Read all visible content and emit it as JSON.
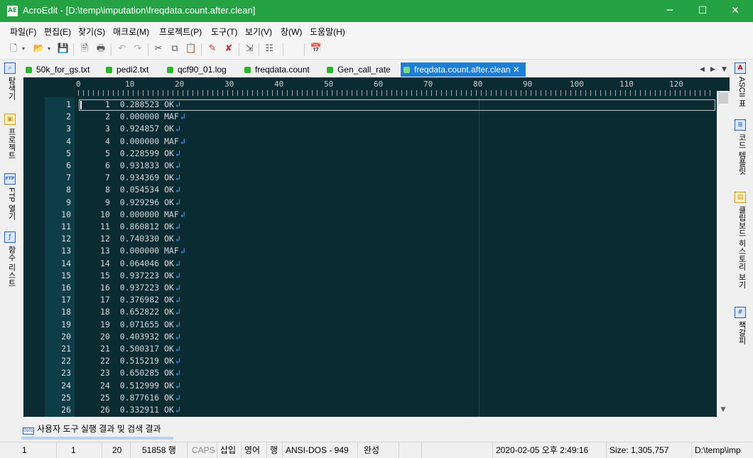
{
  "window": {
    "app_icon_text": "AE",
    "title": "AcroEdit - [D:\\temp\\imputation\\freqdata.count.after.clean]",
    "minimize": "─",
    "maximize": "☐",
    "close": "✕"
  },
  "menu": [
    "파일(F)",
    "편집(E)",
    "찾기(S)",
    "매크로(M)",
    "프로젝트(P)",
    "도구(T)",
    "보기(V)",
    "창(W)",
    "도움말(H)"
  ],
  "left_panel": [
    {
      "icon": "magnifier-icon",
      "label": "탐색기"
    },
    {
      "icon": "project-icon",
      "label": "프로젝트"
    },
    {
      "icon": "ftp-icon",
      "label": "FTP 열기"
    },
    {
      "icon": "function-list-icon",
      "label": "함수 리스트"
    }
  ],
  "right_panel": [
    {
      "icon": "ascii-icon",
      "label": "ASCII 표"
    },
    {
      "icon": "code-template-icon",
      "label": "코드 템플릿"
    },
    {
      "icon": "clipboard-icon",
      "label": "클립보드 히스토리 보기"
    },
    {
      "icon": "bookmark-icon",
      "label": "책갈피"
    }
  ],
  "tabs": [
    {
      "label": "50k_for_gs.txt",
      "active": false
    },
    {
      "label": "pedi2.txt",
      "active": false
    },
    {
      "label": "qcf90_01.log",
      "active": false
    },
    {
      "label": "freqdata.count",
      "active": false
    },
    {
      "label": "Gen_call_rate",
      "active": false
    },
    {
      "label": "freqdata.count.after.clean",
      "active": true
    }
  ],
  "tab_close": "✕",
  "ruler": [
    "0",
    "10",
    "20",
    "30",
    "40",
    "50",
    "60",
    "70",
    "80",
    "90",
    "100",
    "110",
    "120"
  ],
  "lines": [
    {
      "n": "1",
      "text": "1  0.288523 OK"
    },
    {
      "n": "2",
      "text": "2  0.000000 MAF"
    },
    {
      "n": "3",
      "text": "3  0.924857 OK"
    },
    {
      "n": "4",
      "text": "4  0.000000 MAF"
    },
    {
      "n": "5",
      "text": "5  0.228599 OK"
    },
    {
      "n": "6",
      "text": "6  0.931833 OK"
    },
    {
      "n": "7",
      "text": "7  0.934369 OK"
    },
    {
      "n": "8",
      "text": "8  0.054534 OK"
    },
    {
      "n": "9",
      "text": "9  0.929296 OK"
    },
    {
      "n": "10",
      "text": "10  0.000000 MAF"
    },
    {
      "n": "11",
      "text": "11  0.860812 OK"
    },
    {
      "n": "12",
      "text": "12  0.740330 OK"
    },
    {
      "n": "13",
      "text": "13  0.000000 MAF"
    },
    {
      "n": "14",
      "text": "14  0.064046 OK"
    },
    {
      "n": "15",
      "text": "15  0.937223 OK"
    },
    {
      "n": "16",
      "text": "16  0.937223 OK"
    },
    {
      "n": "17",
      "text": "17  0.376982 OK"
    },
    {
      "n": "18",
      "text": "18  0.652822 OK"
    },
    {
      "n": "19",
      "text": "19  0.071655 OK"
    },
    {
      "n": "20",
      "text": "20  0.403932 OK"
    },
    {
      "n": "21",
      "text": "21  0.500317 OK"
    },
    {
      "n": "22",
      "text": "22  0.515219 OK"
    },
    {
      "n": "23",
      "text": "23  0.650285 OK"
    },
    {
      "n": "24",
      "text": "24  0.512999 OK"
    },
    {
      "n": "25",
      "text": "25  0.877616 OK"
    },
    {
      "n": "26",
      "text": "26  0.332911 OK"
    }
  ],
  "eol_glyph": "↲",
  "output_panel": {
    "icon_text": "0101",
    "label": "사용자 도구 실행 결과 및 검색 결과"
  },
  "status": {
    "line": "1",
    "col": "1",
    "tab": "20",
    "total_lines": "51858 행",
    "caps": "CAPS",
    "insert": "삽입",
    "lang": "영어",
    "unit": "행",
    "encoding": "ANSI-DOS - 949",
    "state": "완성",
    "datetime": "2020-02-05 오후 2:49:16",
    "size": "Size: 1,305,757",
    "path": "D:\\temp\\imp"
  },
  "colors": {
    "titlebar": "#25a244",
    "editor_bg": "#0b2b33",
    "active_tab": "#1c7ed6",
    "eol": "#4aa3ff"
  }
}
